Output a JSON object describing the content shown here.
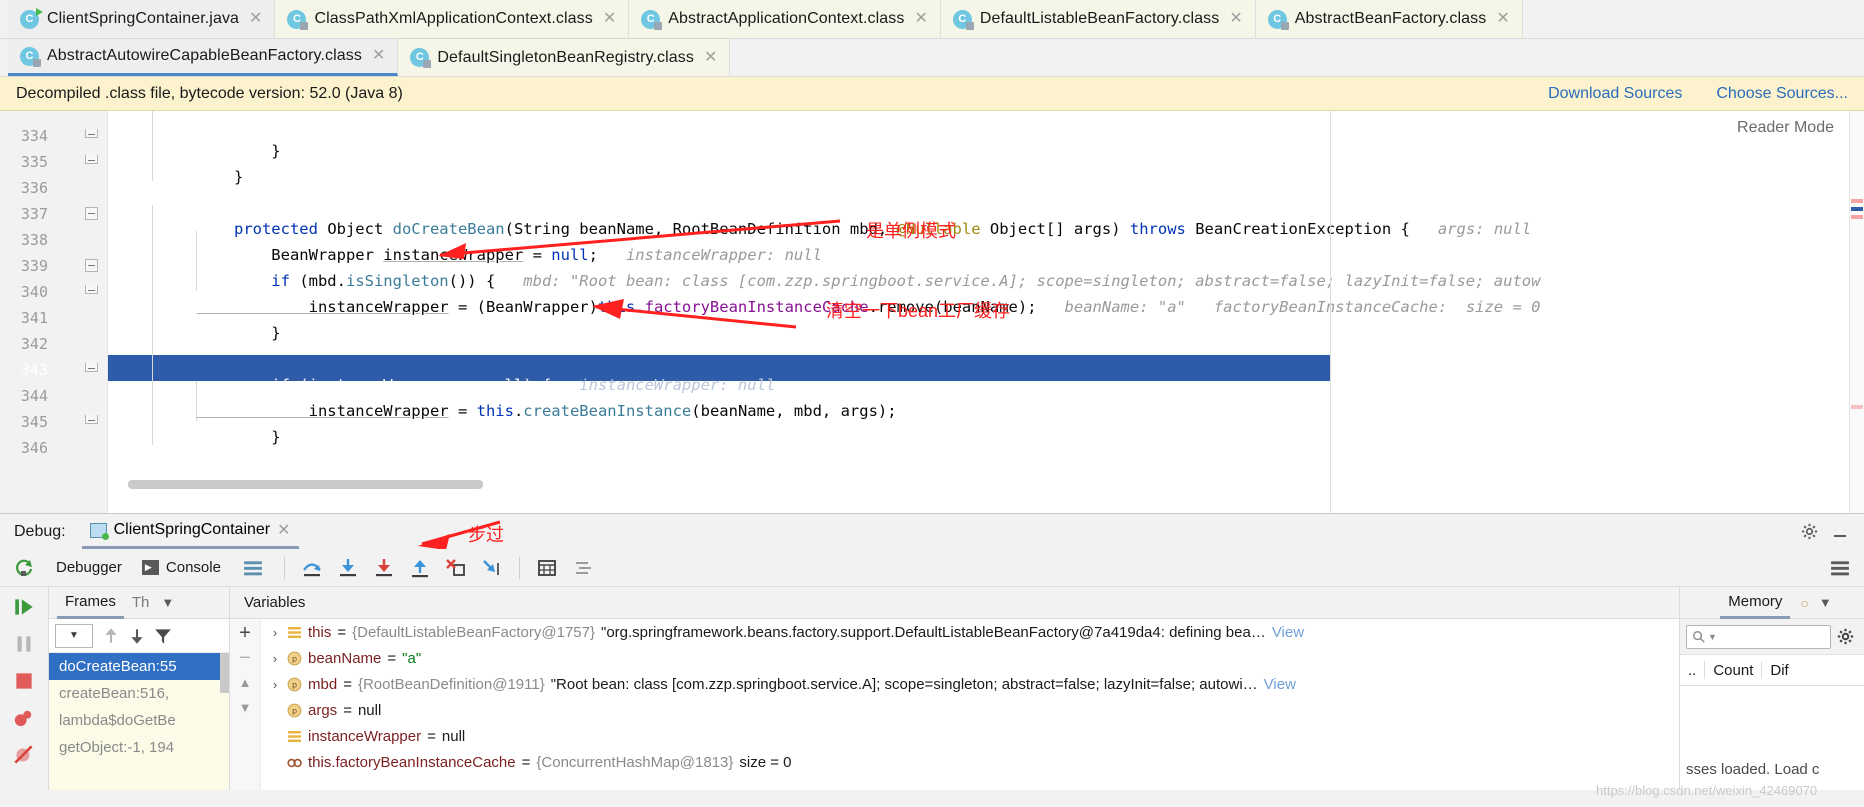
{
  "tabs_row1": [
    {
      "label": "ClientSpringContainer.java",
      "icon": "java-class-icon",
      "state": "active"
    },
    {
      "label": "ClassPathXmlApplicationContext.class",
      "icon": "decompiled-class-icon",
      "state": "inactive"
    },
    {
      "label": "AbstractApplicationContext.class",
      "icon": "decompiled-class-icon",
      "state": "inactive"
    },
    {
      "label": "DefaultListableBeanFactory.class",
      "icon": "decompiled-class-icon",
      "state": "inactive"
    },
    {
      "label": "AbstractBeanFactory.class",
      "icon": "decompiled-class-icon",
      "state": "inactive"
    }
  ],
  "tabs_row2": [
    {
      "label": "AbstractAutowireCapableBeanFactory.class",
      "icon": "decompiled-class-icon",
      "state": "selected"
    },
    {
      "label": "DefaultSingletonBeanRegistry.class",
      "icon": "decompiled-class-icon",
      "state": "inactive"
    }
  ],
  "notification": {
    "message": "Decompiled .class file, bytecode version: 52.0 (Java 8)",
    "download_label": "Download Sources",
    "choose_label": "Choose Sources..."
  },
  "editor": {
    "reader_mode": "Reader Mode",
    "line_numbers": [
      "334",
      "335",
      "336",
      "337",
      "338",
      "339",
      "340",
      "341",
      "342",
      "343",
      "344",
      "345",
      "346"
    ],
    "highlighted_line": "343",
    "lines": [
      {
        "num": "334",
        "text": "        }"
      },
      {
        "num": "335",
        "text": "    }"
      },
      {
        "num": "336",
        "text": ""
      },
      {
        "num": "337",
        "text": "    protected Object doCreateBean(String beanName, RootBeanDefinition mbd, @Nullable Object[] args) throws BeanCreationException {",
        "hint": "args: null"
      },
      {
        "num": "338",
        "text": "        BeanWrapper instanceWrapper = null;",
        "hint": "instanceWrapper: null"
      },
      {
        "num": "339",
        "text": "        if (mbd.isSingleton()) {",
        "hint": "mbd: \"Root bean: class [com.zzp.springboot.service.A]; scope=singleton; abstract=false; lazyInit=false; autow"
      },
      {
        "num": "340",
        "text": "            instanceWrapper = (BeanWrapper)this.factoryBeanInstanceCache.remove(beanName);",
        "hint": "beanName: \"a\"   factoryBeanInstanceCache:  size = 0"
      },
      {
        "num": "341",
        "text": "        }"
      },
      {
        "num": "342",
        "text": ""
      },
      {
        "num": "343",
        "text": "        if (instanceWrapper == null) {",
        "hint": "instanceWrapper: null"
      },
      {
        "num": "344",
        "text": "            instanceWrapper = this.createBeanInstance(beanName, mbd, args);"
      },
      {
        "num": "345",
        "text": "        }"
      },
      {
        "num": "346",
        "text": ""
      }
    ],
    "annotations": [
      {
        "text": "是单例模式",
        "name": "annotation-singleton-mode"
      },
      {
        "text": "清空一下bean工厂缓存",
        "name": "annotation-clear-bean-cache"
      }
    ]
  },
  "debug": {
    "label": "Debug:",
    "session_name": "ClientSpringContainer",
    "tabs": [
      {
        "label": "Debugger",
        "icon": "debugger-icon"
      },
      {
        "label": "Console",
        "icon": "console-icon"
      }
    ],
    "toolbar_icons": [
      "step-over-icon",
      "step-into-icon",
      "force-step-into-icon",
      "step-out-icon",
      "drop-frame-icon",
      "run-to-cursor-icon",
      "evaluate-expression-icon",
      "show-frames-icon"
    ],
    "annotation": "步过",
    "run_controls": [
      "resume-icon",
      "pause-icon",
      "stop-icon",
      "view-breakpoints-icon",
      "mute-breakpoints-icon"
    ],
    "frames": {
      "tab_frames": "Frames",
      "tab_threads": "Th",
      "items": [
        {
          "label": "doCreateBean:55",
          "selected": true
        },
        {
          "label": "createBean:516,",
          "selected": false
        },
        {
          "label": "lambda$doGetBe",
          "selected": false
        },
        {
          "label": "getObject:-1, 194",
          "selected": false
        }
      ]
    },
    "variables": {
      "title": "Variables",
      "rows": [
        {
          "chevron": "›",
          "icon": "object-icon",
          "name": "this",
          "eq": "=",
          "ref": "{DefaultListableBeanFactory@1757}",
          "value": "\"org.springframework.beans.factory.support.DefaultListableBeanFactory@7a419da4: defining bea…",
          "view": "View"
        },
        {
          "chevron": "›",
          "icon": "param-icon",
          "name": "beanName",
          "eq": "=",
          "ref": "",
          "value": "\"a\"",
          "view": ""
        },
        {
          "chevron": "›",
          "icon": "param-icon",
          "name": "mbd",
          "eq": "=",
          "ref": "{RootBeanDefinition@1911}",
          "value": "\"Root bean: class [com.zzp.springboot.service.A]; scope=singleton; abstract=false; lazyInit=false; autowi…",
          "view": "View"
        },
        {
          "chevron": "",
          "icon": "param-icon",
          "name": "args",
          "eq": "=",
          "ref": "",
          "value": "null",
          "view": ""
        },
        {
          "chevron": "",
          "icon": "object-icon",
          "name": "instanceWrapper",
          "eq": "=",
          "ref": "",
          "value": "null",
          "view": ""
        },
        {
          "chevron": "",
          "icon": "field-icon",
          "name": "this.factoryBeanInstanceCache",
          "eq": "=",
          "ref": "{ConcurrentHashMap@1813}",
          "value": "size = 0",
          "view": ""
        }
      ]
    },
    "memory": {
      "title": "Memory",
      "search_placeholder": "",
      "columns": [
        "..",
        "Count",
        "Dif"
      ],
      "footer": "sses loaded. Load c"
    }
  },
  "watermark": "https://blog.csdn.net/weixin_42469070",
  "colors": {
    "accent_blue": "#2f5ca8",
    "selection_blue": "#2f6fc4",
    "annotation_red": "#ff2020",
    "notif_yellow": "#fcf3ce",
    "tab_yellow": "#f6f6e8"
  }
}
